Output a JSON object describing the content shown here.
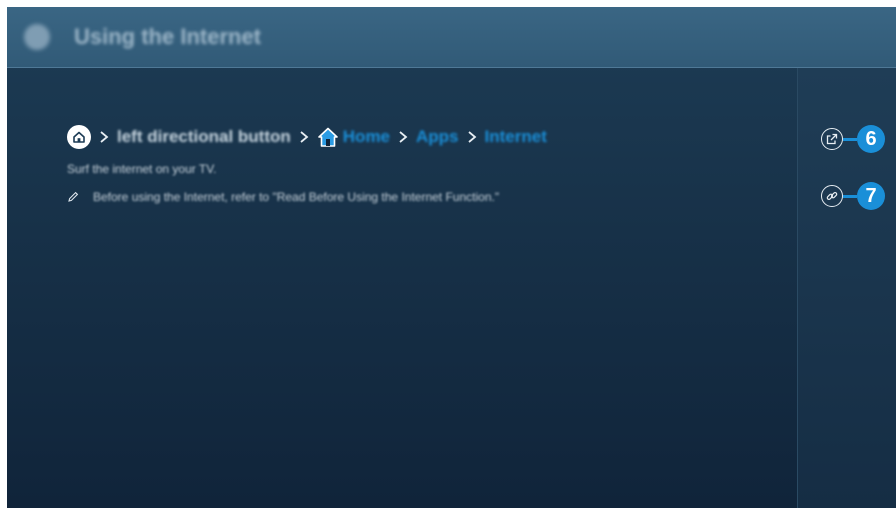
{
  "header": {
    "title": "Using the Internet",
    "icon": "app-icon"
  },
  "breadcrumb": {
    "home_icon": "home-icon",
    "steps": [
      {
        "label": "left directional button",
        "style": "text"
      },
      {
        "label": "Home",
        "style": "link",
        "icon": "home-icon"
      },
      {
        "label": "Apps",
        "style": "link"
      },
      {
        "label": "Internet",
        "style": "link"
      }
    ]
  },
  "content": {
    "description": "Surf the internet on your TV.",
    "note": "Before using the Internet, refer to \"Read Before Using the Internet Function.\"",
    "note_icon": "pencil-icon"
  },
  "callouts": [
    {
      "number": "6",
      "icon": "external-link-icon"
    },
    {
      "number": "7",
      "icon": "link-icon"
    }
  ],
  "colors": {
    "accent": "#1a8fd8",
    "background": "#173148",
    "header": "#3a6684"
  }
}
